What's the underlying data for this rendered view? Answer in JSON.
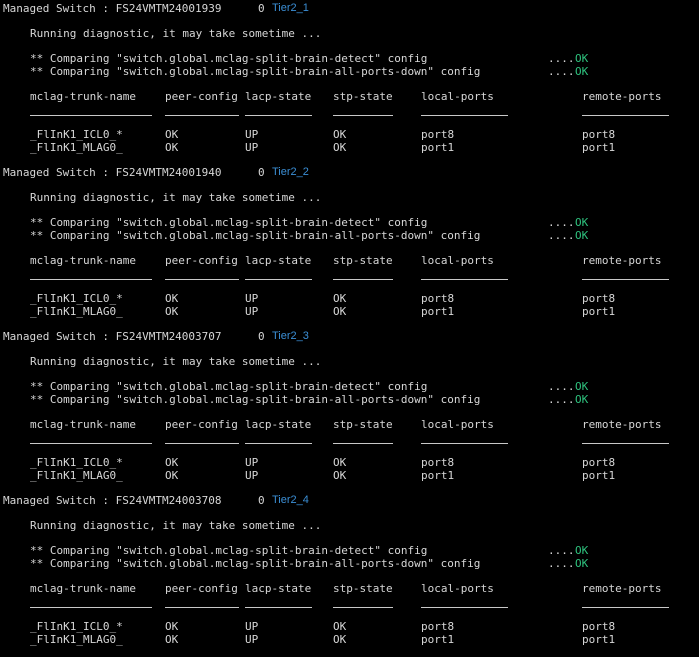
{
  "switches": [
    {
      "header_prefix": "Managed Switch : FS24VMTM24001939",
      "count": "0",
      "tier": "Tier2_1",
      "running": "Running diagnostic, it may take sometime ...",
      "comparisons": [
        {
          "text": "** Comparing \"switch.global.mclag-split-brain-detect\" config",
          "dots": "....",
          "status": "OK"
        },
        {
          "text": "** Comparing \"switch.global.mclag-split-brain-all-ports-down\" config",
          "dots": "....",
          "status": "OK"
        }
      ],
      "columns": [
        "mclag-trunk-name",
        "peer-config",
        "lacp-state",
        "stp-state",
        "local-ports",
        "remote-ports"
      ],
      "rows": [
        [
          "_FlInK1_ICL0_*",
          "OK",
          "UP",
          "OK",
          "port8",
          "port8"
        ],
        [
          "_FlInK1_MLAG0_",
          "OK",
          "UP",
          "OK",
          "port1",
          "port1"
        ]
      ]
    },
    {
      "header_prefix": "Managed Switch : FS24VMTM24001940",
      "count": "0",
      "tier": "Tier2_2",
      "running": "Running diagnostic, it may take sometime ...",
      "comparisons": [
        {
          "text": "** Comparing \"switch.global.mclag-split-brain-detect\" config",
          "dots": "....",
          "status": "OK"
        },
        {
          "text": "** Comparing \"switch.global.mclag-split-brain-all-ports-down\" config",
          "dots": "....",
          "status": "OK"
        }
      ],
      "columns": [
        "mclag-trunk-name",
        "peer-config",
        "lacp-state",
        "stp-state",
        "local-ports",
        "remote-ports"
      ],
      "rows": [
        [
          "_FlInK1_ICL0_*",
          "OK",
          "UP",
          "OK",
          "port8",
          "port8"
        ],
        [
          "_FlInK1_MLAG0_",
          "OK",
          "UP",
          "OK",
          "port1",
          "port1"
        ]
      ]
    },
    {
      "header_prefix": "Managed Switch : FS24VMTM24003707",
      "count": "0",
      "tier": "Tier2_3",
      "running": "Running diagnostic, it may take sometime ...",
      "comparisons": [
        {
          "text": "** Comparing \"switch.global.mclag-split-brain-detect\" config",
          "dots": "....",
          "status": "OK"
        },
        {
          "text": "** Comparing \"switch.global.mclag-split-brain-all-ports-down\" config",
          "dots": "....",
          "status": "OK"
        }
      ],
      "columns": [
        "mclag-trunk-name",
        "peer-config",
        "lacp-state",
        "stp-state",
        "local-ports",
        "remote-ports"
      ],
      "rows": [
        [
          "_FlInK1_ICL0_*",
          "OK",
          "UP",
          "OK",
          "port8",
          "port8"
        ],
        [
          "_FlInK1_MLAG0_",
          "OK",
          "UP",
          "OK",
          "port1",
          "port1"
        ]
      ]
    },
    {
      "header_prefix": "Managed Switch : FS24VMTM24003708",
      "count": "0",
      "tier": "Tier2_4",
      "running": "Running diagnostic, it may take sometime ...",
      "comparisons": [
        {
          "text": "** Comparing \"switch.global.mclag-split-brain-detect\" config",
          "dots": "....",
          "status": "OK"
        },
        {
          "text": "** Comparing \"switch.global.mclag-split-brain-all-ports-down\" config",
          "dots": "....",
          "status": "OK"
        }
      ],
      "columns": [
        "mclag-trunk-name",
        "peer-config",
        "lacp-state",
        "stp-state",
        "local-ports",
        "remote-ports"
      ],
      "rows": [
        [
          "_FlInK1_ICL0_*",
          "OK",
          "UP",
          "OK",
          "port8",
          "port8"
        ],
        [
          "_FlInK1_MLAG0_",
          "OK",
          "UP",
          "OK",
          "port1",
          "port1"
        ]
      ]
    }
  ],
  "colors": {
    "background": "#000000",
    "text": "#d7d7d7",
    "ok": "#2ec27e",
    "tier_link": "#3b8fd6"
  }
}
